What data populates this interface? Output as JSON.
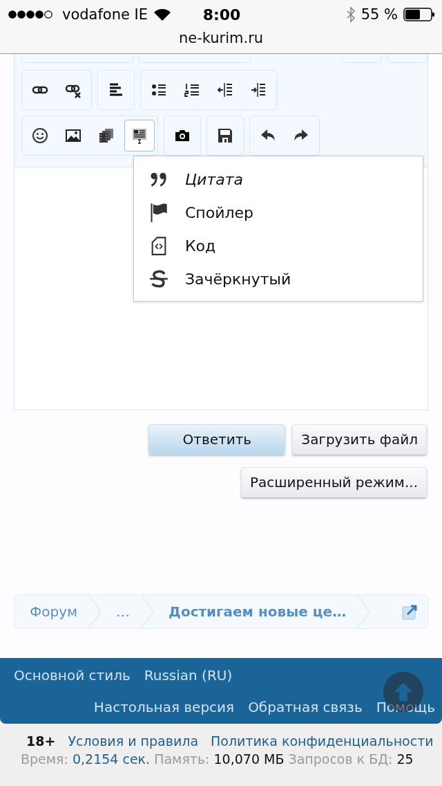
{
  "status_bar": {
    "carrier": "vodafone IE",
    "time": "8:00",
    "battery": "55 %",
    "url": "ne-kurim.ru"
  },
  "editor": {
    "toolbar_rows": [
      [
        [
          {
            "kind": "link",
            "selected": false
          },
          {
            "kind": "unlink",
            "selected": false
          }
        ],
        [
          {
            "kind": "align-left",
            "selected": false
          }
        ],
        [
          {
            "kind": "bullet-list",
            "selected": false
          },
          {
            "kind": "numbered-list",
            "selected": false
          },
          {
            "kind": "outdent",
            "selected": false
          },
          {
            "kind": "indent",
            "selected": false
          }
        ]
      ],
      [
        [
          {
            "kind": "smiley",
            "selected": false
          },
          {
            "kind": "image",
            "selected": false
          },
          {
            "kind": "media",
            "selected": false
          },
          {
            "kind": "insert",
            "selected": true
          }
        ],
        [
          {
            "kind": "camera",
            "selected": false
          }
        ],
        [
          {
            "kind": "save",
            "selected": false
          }
        ],
        [
          {
            "kind": "undo",
            "selected": false
          },
          {
            "kind": "redo",
            "selected": false
          }
        ]
      ]
    ]
  },
  "menu": {
    "items": [
      {
        "kind": "quote",
        "label": "Цитата",
        "italic": true
      },
      {
        "kind": "spoiler",
        "label": "Спойлер",
        "italic": false
      },
      {
        "kind": "code",
        "label": "Код",
        "italic": false
      },
      {
        "kind": "strike",
        "label": "Зачёркнутый",
        "italic": false
      }
    ]
  },
  "button_rows": [
    [
      {
        "label": "Ответить",
        "primary": true
      },
      {
        "label": "Загрузить файл",
        "primary": false
      }
    ],
    [
      {
        "label": "Расширенный режим...",
        "primary": false
      }
    ]
  ],
  "breadcrumb": {
    "items": [
      {
        "label": "Форум",
        "current": false
      },
      {
        "label": "…",
        "current": false
      },
      {
        "label": "Достигаем новые це…",
        "current": true
      }
    ]
  },
  "footer": {
    "row_1": [
      "Основной стиль",
      "Russian (RU)"
    ],
    "row_2": [
      "Настольная версия",
      "Обратная связь",
      "Помощь"
    ]
  },
  "legal": {
    "age": "18+",
    "links": [
      "Условия и правила",
      "Политика конфиденциальности"
    ]
  },
  "stats": [
    {
      "label": "Время:",
      "value": "0,2154 сек.",
      "kind": "link"
    },
    {
      "label": "Память:",
      "value": "10,070 МБ",
      "kind": "plain"
    },
    {
      "label": "Запросов к БД:",
      "value": "25",
      "kind": "plain"
    }
  ]
}
